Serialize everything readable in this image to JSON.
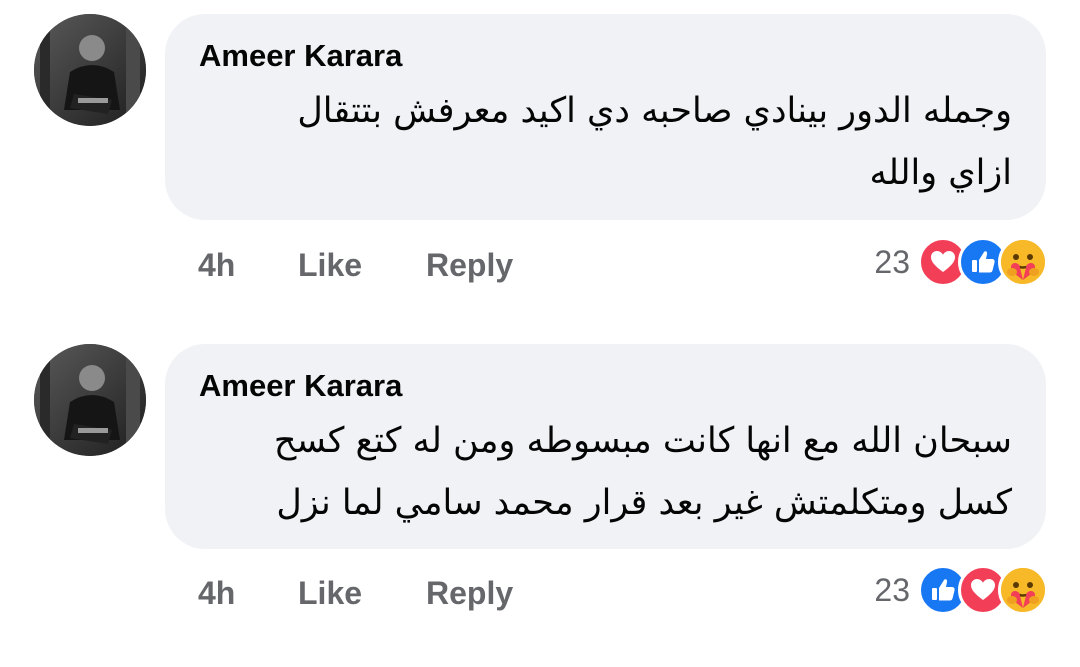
{
  "comments": [
    {
      "author": "Ameer Karara",
      "text_line1": "وجمله الدور بينادي صاحبه دي اكيد معرفش بتتقال",
      "text_line2": "ازاي والله",
      "time": "4h",
      "like_label": "Like",
      "reply_label": "Reply",
      "reaction_count": "23",
      "reactions": [
        "love-icon",
        "like-icon",
        "care-icon"
      ]
    },
    {
      "author": "Ameer Karara",
      "text_line1": "سبحان الله مع انها كانت مبسوطه ومن له كتع كسح",
      "text_line2": "كسل ومتكلمتش غير بعد قرار محمد سامي لما نزل",
      "time": "4h",
      "like_label": "Like",
      "reply_label": "Reply",
      "reaction_count": "23",
      "reactions": [
        "like-icon",
        "love-icon",
        "care-icon"
      ]
    }
  ],
  "colors": {
    "bubble_bg": "#f0f2f5",
    "meta_text": "#65676b",
    "like_blue": "#1877f2",
    "love_red": "#f33e58",
    "care_yellow": "#f7b928"
  }
}
